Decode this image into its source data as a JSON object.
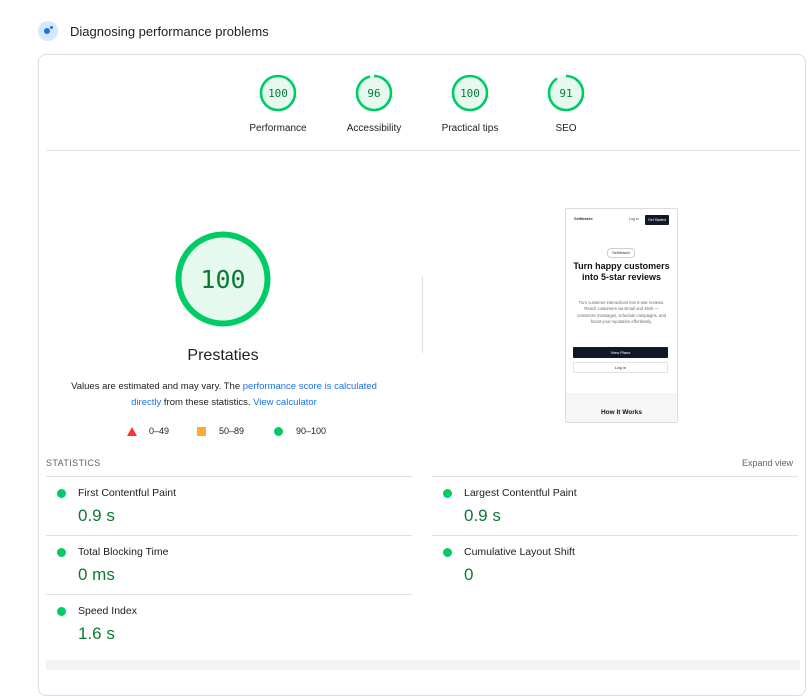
{
  "header": {
    "title": "Diagnosing performance problems"
  },
  "gauges": [
    {
      "score": 100,
      "label": "Performance"
    },
    {
      "score": 96,
      "label": "Accessibility"
    },
    {
      "score": 100,
      "label": "Practical tips"
    },
    {
      "score": 91,
      "label": "SEO"
    }
  ],
  "performance": {
    "score": 100,
    "title": "Prestaties",
    "desc_prefix": "Values are estimated and may vary. The ",
    "link_score": "performance score is calculated directly",
    "desc_middle": " from these statistics. ",
    "link_calculator": "View calculator"
  },
  "legend": [
    {
      "range": "0–49",
      "color": "#ff3333"
    },
    {
      "range": "50–89",
      "color": "#ffaa33"
    },
    {
      "range": "90–100",
      "color": "#00cc66"
    }
  ],
  "screenshot": {
    "logo": "GetMeasire",
    "login": "Log in",
    "get_started": "Get Started",
    "badge": "GetMeasire",
    "headline": "Turn happy customers into 5-star reviews",
    "subtext": "Turn customer interactions into 5-star reviews. Reach customers via Email and SMS — customize messages, schedule campaigns, and boost your reputation effortlessly.",
    "primary_button": "View Plans",
    "secondary_button": "Log in",
    "section_title": "How It Works"
  },
  "statistics": {
    "title": "STATISTICS",
    "expand": "Expand view",
    "metrics": [
      {
        "label": "First Contentful Paint",
        "value": "0.9 s"
      },
      {
        "label": "Largest Contentful Paint",
        "value": "0.9 s"
      },
      {
        "label": "Total Blocking Time",
        "value": "0 ms"
      },
      {
        "label": "Cumulative Layout Shift",
        "value": "0"
      },
      {
        "label": "Speed Index",
        "value": "1.6 s"
      }
    ]
  },
  "colors": {
    "pass": "#00cc66",
    "pass_text": "#0c7a33",
    "gauge_fill": "#e6f9ee",
    "link": "#1a73e8"
  }
}
